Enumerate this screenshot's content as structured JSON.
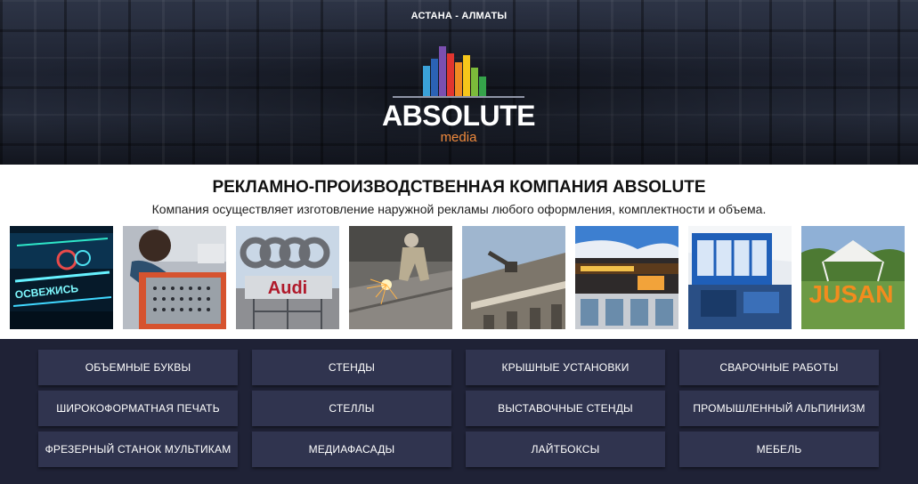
{
  "header": {
    "city_label": "АСТАНА - АЛМАТЫ",
    "logo": {
      "name": "ABSOLUTE",
      "sub": "media",
      "bar_colors": [
        "#3aa1d8",
        "#2b62b5",
        "#7b4fb0",
        "#e1352f",
        "#f08a22",
        "#f6c61a",
        "#7cbb3a",
        "#35a34a"
      ]
    }
  },
  "intro": {
    "headline": "РЕКЛАМНО-ПРОИЗВОДСТВЕННАЯ КОМПАНИЯ ABSOLUTE",
    "subline": "Компания осуществляет изготовление наружной рекламы любого оформления, комплектности и объема."
  },
  "gallery": {
    "photos": [
      {
        "name": "neon-signage-photo",
        "text": "ОСВЕЖИСЬ"
      },
      {
        "name": "led-assembly-photo"
      },
      {
        "name": "audi-rooftop-sign-photo",
        "text": "Audi"
      },
      {
        "name": "welding-work-photo"
      },
      {
        "name": "facade-install-photo"
      },
      {
        "name": "shop-facade-photo"
      },
      {
        "name": "exhibition-stand-photo"
      },
      {
        "name": "jusan-letters-photo",
        "text": "JUSAN"
      }
    ]
  },
  "services": {
    "items": [
      {
        "label": "ОБЪЕМНЫЕ БУКВЫ"
      },
      {
        "label": "СТЕНДЫ"
      },
      {
        "label": "КРЫШНЫЕ УСТАНОВКИ"
      },
      {
        "label": "СВАРОЧНЫЕ РАБОТЫ"
      },
      {
        "label": "ШИРОКОФОРМАТНАЯ ПЕЧАТЬ"
      },
      {
        "label": "СТЕЛЛЫ"
      },
      {
        "label": "ВЫСТАВОЧНЫЕ СТЕНДЫ"
      },
      {
        "label": "ПРОМЫШЛЕННЫЙ АЛЬПИНИЗМ"
      },
      {
        "label": "ФРЕЗЕРНЫЙ СТАНОК МУЛЬТИКАМ"
      },
      {
        "label": "МЕДИАФАСАДЫ"
      },
      {
        "label": "ЛАЙТБОКСЫ"
      },
      {
        "label": "МЕБЕЛЬ"
      }
    ]
  },
  "colors": {
    "accent": "#f08a3c",
    "button_bg": "#30344f",
    "page_bg": "#1f2236"
  }
}
